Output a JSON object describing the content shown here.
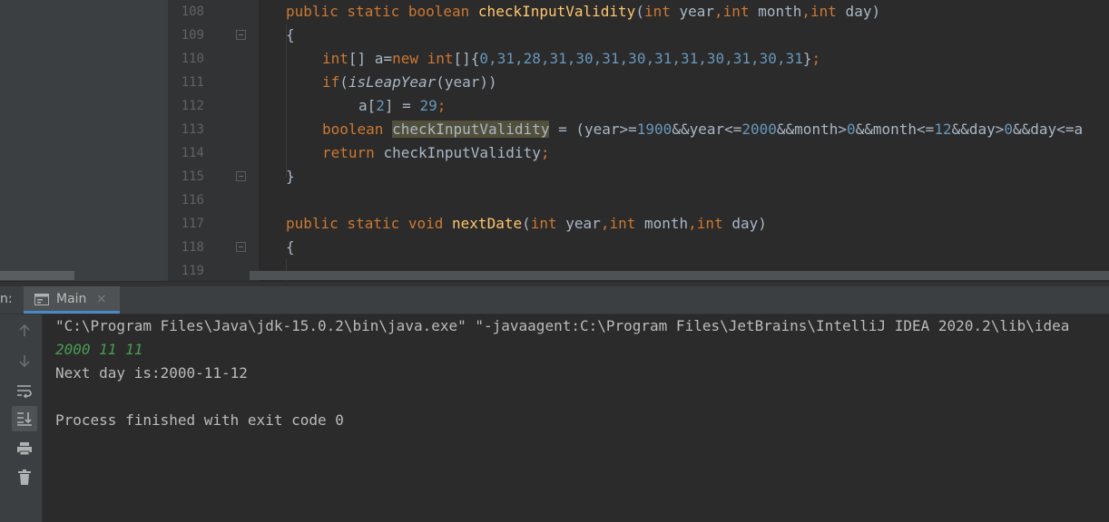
{
  "editor": {
    "lines": [
      {
        "num": "108"
      },
      {
        "num": "109"
      },
      {
        "num": "110"
      },
      {
        "num": "111"
      },
      {
        "num": "112"
      },
      {
        "num": "113"
      },
      {
        "num": "114"
      },
      {
        "num": "115"
      },
      {
        "num": "116"
      },
      {
        "num": "117"
      },
      {
        "num": "118"
      },
      {
        "num": "119"
      }
    ],
    "code": {
      "l108": {
        "kw1": "public static boolean ",
        "fn": "checkInputValidity",
        "p1": "(",
        "kw2": "int",
        " t1": " year",
        "c1": ",",
        "kw3": "int",
        "t2": " month",
        "c2": ",",
        "kw4": "int",
        "t3": " day)"
      },
      "l109": {
        "t": "{"
      },
      "l110": {
        "kw1": "int",
        "t1": "[] a=",
        "kw2": "new ",
        "kw3": "int",
        "t2": "[]{",
        "nums": "0,31,28,31,30,31,30,31,31,30,31,30,31",
        "t3": "}",
        ";": ";"
      },
      "l111": {
        "kw1": "if",
        "t1": "(",
        "it": "isLeapYear",
        "t2": "(year))"
      },
      "l112": {
        "t1": "a[",
        "n1": "2",
        "t2": "] = ",
        "n2": "29",
        "t3": ";"
      },
      "l113": {
        "kw1": "boolean ",
        "hl": "checkInputValidity",
        "t1": " = (year>=",
        "n1": "1900",
        "t2": "&&year<=",
        "n2": "2000",
        "t3": "&&month>",
        "n3": "0",
        "t4": "&&month<=",
        "n4": "12",
        "t5": "&&day>",
        "n5": "0",
        "t6": "&&day<=a"
      },
      "l114": {
        "kw1": "return ",
        "t1": "checkInputValidity",
        "t2": ";"
      },
      "l115": {
        "t": "}"
      },
      "l117": {
        "kw1": "public static void ",
        "fn": "nextDate",
        "t1": "(",
        "kw2": "int",
        "t2": " year",
        "c1": ",",
        "kw3": "int",
        "t3": " month",
        "c2": ",",
        "kw4": "int",
        "t4": " day)"
      },
      "l118": {
        "t": "{"
      }
    }
  },
  "run_panel": {
    "run_label": "n:",
    "tab_label": "Main",
    "tab_close": "×"
  },
  "console": {
    "lines": [
      {
        "text": "\"C:\\Program Files\\Java\\jdk-15.0.2\\bin\\java.exe\" \"-javaagent:C:\\Program Files\\JetBrains\\IntelliJ IDEA 2020.2\\lib\\idea",
        "type": "out"
      },
      {
        "text": "2000 11 11",
        "type": "in"
      },
      {
        "text": "Next day is:2000-11-12",
        "type": "out"
      },
      {
        "text": "",
        "type": "out"
      },
      {
        "text": "Process finished with exit code 0",
        "type": "out"
      }
    ]
  },
  "toolbar": {
    "buttons": [
      "up-arrow-icon",
      "down-arrow-icon",
      "soft-wrap-icon",
      "scroll-to-end-icon",
      "print-icon",
      "trash-icon"
    ]
  },
  "colors": {
    "keyword": "#cc7832",
    "method": "#ffc66d",
    "number": "#6897bb",
    "text": "#a9b7c6",
    "user_input": "#499c54",
    "background": "#2b2b2b"
  }
}
